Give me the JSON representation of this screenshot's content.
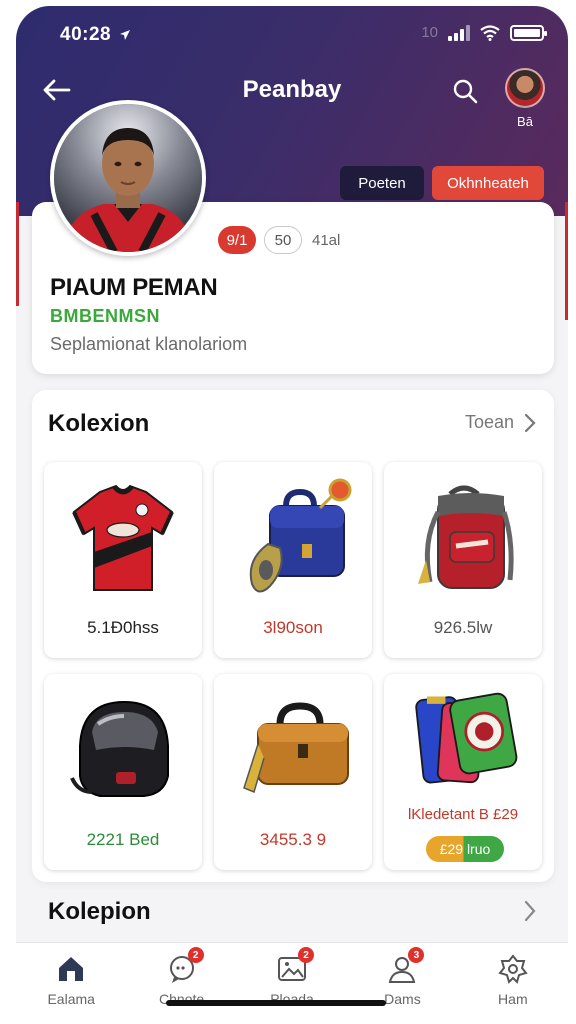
{
  "status_bar": {
    "time": "40:28",
    "extra": "10"
  },
  "header": {
    "title": "Peanbay",
    "user_label": "Bā",
    "btn_secondary": "Poeten",
    "btn_primary": "Okhnheateh"
  },
  "profile": {
    "stat_1": "9/1",
    "stat_2": "50",
    "stat_3": "41al",
    "name": "PIAUM PEMAN",
    "tag": "BMBENMSN",
    "description": "Seplamionat  klanolariom"
  },
  "collection": {
    "title": "Kolexion",
    "see_all": "Toean",
    "items": [
      {
        "name": "jersey",
        "price": "5.1Ð0hss",
        "price_color": "#222222"
      },
      {
        "name": "bag",
        "price": "3l90son",
        "price_color": "#c0392b"
      },
      {
        "name": "backpack",
        "price": "926.5lw",
        "price_color": "#555555"
      },
      {
        "name": "helmet",
        "price": "2221 Bed",
        "price_color": "#2e8b3a"
      },
      {
        "name": "case",
        "price": "3455.3 9",
        "price_color": "#c0392b"
      },
      {
        "name": "bundle",
        "price": "lKledetant  B £29",
        "price_color": "#c0392b",
        "tag": "£29  lruo"
      }
    ]
  },
  "section2": {
    "title": "Kolepion"
  },
  "bottom_nav": [
    {
      "label": "Ealama",
      "icon": "home-icon",
      "badge": ""
    },
    {
      "label": "Chnote",
      "icon": "chat-icon",
      "badge": "2"
    },
    {
      "label": "Ploada",
      "icon": "image-icon",
      "badge": "2"
    },
    {
      "label": "Dams",
      "icon": "profile-icon",
      "badge": "3"
    },
    {
      "label": "Ham",
      "icon": "settings-icon",
      "badge": ""
    }
  ],
  "colors": {
    "accent_red": "#e2483a",
    "header_purple": "#3a2d6a",
    "green": "#3aa83a"
  }
}
